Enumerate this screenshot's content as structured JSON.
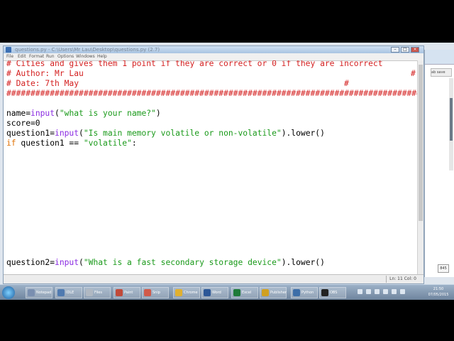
{
  "window": {
    "title": "questions.py - C:\\Users\\Mr Lau\\Desktop\\questions.py (2.7)",
    "menu": [
      "File",
      "Edit",
      "Format",
      "Run",
      "Options",
      "Windows",
      "Help"
    ]
  },
  "code": {
    "comment_lines": [
      "# Cities and gives them 1 point if they are correct or 0 if they are incorrect",
      "# Author: Mr Lau",
      "# Date: 7th May",
      "##################################################################################################"
    ],
    "author_hash": "#",
    "date_hash": "#",
    "line_name": {
      "var": "name=",
      "fn": "input",
      "open": "(",
      "str": "\"what is your name?\"",
      "close": ")"
    },
    "line_score": "score=0",
    "line_q1": {
      "var": "question1=",
      "fn": "input",
      "open": "(",
      "str": "\"Is main memory volatile or non-volatile\"",
      "close": ").lower()"
    },
    "line_if": {
      "kw": "if",
      "rest": " question1 == ",
      "str": "\"volatile\"",
      "colon": ":"
    },
    "line_q2": {
      "var": "question2=",
      "fn": "input",
      "open": "(",
      "str": "\"What is a fast secondary storage device\"",
      "close": ").lower()"
    }
  },
  "status": {
    "position": "Ln: 11 Col: 0"
  },
  "side_window": {
    "tab": "ab save",
    "number": "845"
  },
  "taskbar": {
    "items": [
      {
        "label": "Notepad",
        "color": "#7a8fb0"
      },
      {
        "label": "IDLE",
        "color": "#4f7ab0"
      },
      {
        "label": "Files",
        "color": "#b0b8c2"
      },
      {
        "label": "Paint",
        "color": "#c04a3a"
      },
      {
        "label": "Snip",
        "color": "#d05a4a"
      },
      {
        "label": "Chrome",
        "color": "#e0b030"
      },
      {
        "label": "Word",
        "color": "#2b5797"
      },
      {
        "label": "Excel",
        "color": "#1f7a3a"
      },
      {
        "label": "Publisher",
        "color": "#d0a020"
      },
      {
        "label": "Python",
        "color": "#3d6ea8"
      },
      {
        "label": "OBS",
        "color": "#222222"
      }
    ],
    "clock_time": "21:50",
    "clock_date": "07/05/2015"
  }
}
